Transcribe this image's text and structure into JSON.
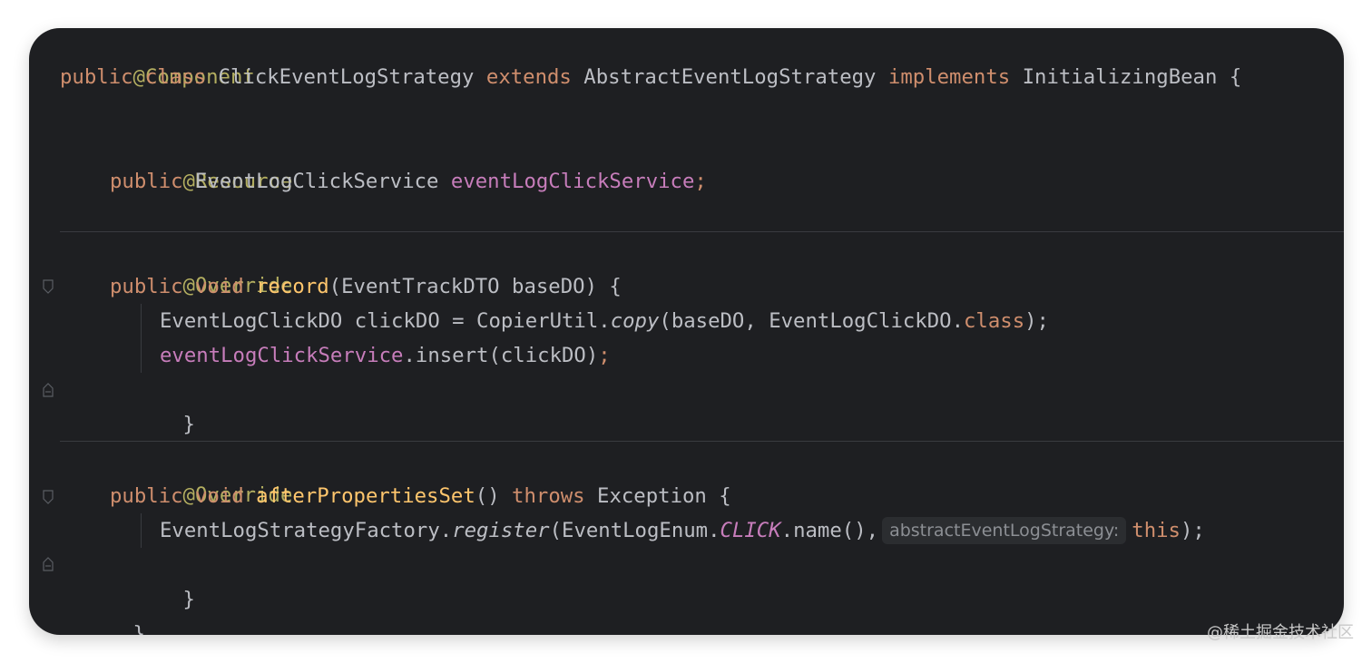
{
  "editor": {
    "lines": {
      "l1": {
        "ann": "@Component"
      },
      "l2": {
        "kw1": "public",
        "kw2": "class",
        "name": "ClickEventLogStrategy",
        "kw3": "extends",
        "base": "AbstractEventLogStrategy",
        "kw4": "implements",
        "iface": "InitializingBean",
        "brace": "{"
      },
      "l4": {
        "ann": "@Resource"
      },
      "l5": {
        "kw": "public",
        "type": "EventLogClickService",
        "field": "eventLogClickService",
        "semi": ";"
      },
      "l7": {
        "ann": "@Override"
      },
      "l8": {
        "kw1": "public",
        "kw2": "void",
        "fn": "record",
        "rest": "(EventTrackDTO baseDO) {"
      },
      "l9": {
        "p1": "EventLogClickDO clickDO = CopierUtil.",
        "fn": "copy",
        "p2": "(baseDO, EventLogClickDO.",
        "kw": "class",
        "p3": ");"
      },
      "l10": {
        "field": "eventLogClickService",
        "p1": ".insert(clickDO)",
        "semi": ";"
      },
      "l11": {
        "brace": "}"
      },
      "l13": {
        "ann": "@Override"
      },
      "l14": {
        "kw1": "public",
        "kw2": "void",
        "fn": "afterPropertiesSet",
        "p1": "() ",
        "kw3": "throws",
        "p2": "Exception {"
      },
      "l15": {
        "p1": "EventLogStrategyFactory.",
        "fn": "register",
        "p2": "(EventLogEnum.",
        "const": "CLICK",
        "p3": ".name(),",
        "hint": "abstractEventLogStrategy:",
        "kw": "this",
        "p4": ");"
      },
      "l16": {
        "brace": "}"
      },
      "l17": {
        "brace": "}"
      }
    },
    "colors": {
      "background": "#1e1f22",
      "keyword": "#cf8e6d",
      "annotation": "#b3ae60",
      "field": "#c77dbb",
      "method_declaration": "#ffc66d",
      "text": "#bcbec4"
    }
  },
  "watermark": "@稀土掘金技术社区"
}
